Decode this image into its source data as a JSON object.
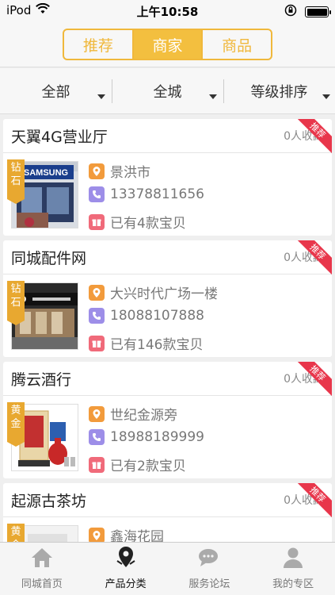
{
  "status": {
    "carrier": "iPod",
    "time": "上午10:58"
  },
  "segments": [
    {
      "label": "推荐",
      "active": false
    },
    {
      "label": "商家",
      "active": true
    },
    {
      "label": "商品",
      "active": false
    }
  ],
  "filters": [
    {
      "label": "全部"
    },
    {
      "label": "全城"
    },
    {
      "label": "等级排序"
    }
  ],
  "shops": [
    {
      "name": "天翼4G营业厅",
      "fav": "0人收藏",
      "badge": "钻石",
      "address": "景洪市",
      "phone": "13378811656",
      "items": "已有4款宝贝",
      "ribbon": "推荐"
    },
    {
      "name": "同城配件网",
      "fav": "0人收藏",
      "badge": "钻石",
      "address": "大兴时代广场一楼",
      "phone": "18088107888",
      "items": "已有146款宝贝",
      "ribbon": "推荐"
    },
    {
      "name": "腾云酒行",
      "fav": "0人收藏",
      "badge": "黄金",
      "address": "世纪金源旁",
      "phone": "18988189999",
      "items": "已有2款宝贝",
      "ribbon": "推荐"
    },
    {
      "name": "起源古茶坊",
      "fav": "0人收藏",
      "badge": "黄金",
      "address": "鑫海花园",
      "phone": "",
      "items": "",
      "ribbon": "推荐"
    }
  ],
  "tabs": [
    {
      "label": "同城首页",
      "icon": "home-icon",
      "active": false
    },
    {
      "label": "产品分类",
      "icon": "map-pin-icon",
      "active": true
    },
    {
      "label": "服务论坛",
      "icon": "chat-icon",
      "active": false
    },
    {
      "label": "我的专区",
      "icon": "user-icon",
      "active": false
    }
  ],
  "colors": {
    "accent": "#f3bf3f",
    "ribbon": "#e8364b",
    "badge": "#e8a830"
  }
}
